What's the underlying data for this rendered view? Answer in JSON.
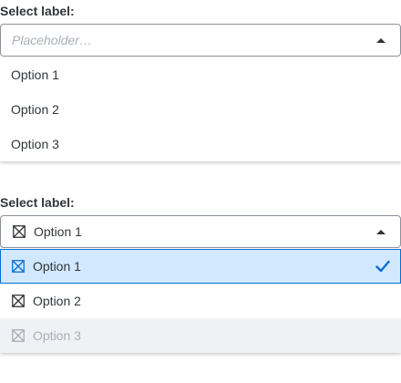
{
  "select1": {
    "label": "Select label:",
    "placeholder": "Placeholder…",
    "options": [
      {
        "label": "Option 1"
      },
      {
        "label": "Option 2"
      },
      {
        "label": "Option 3"
      }
    ]
  },
  "select2": {
    "label": "Select label:",
    "selected_value": "Option 1",
    "options": [
      {
        "label": "Option 1",
        "icon": "x-box-icon",
        "state": "selected"
      },
      {
        "label": "Option 2",
        "icon": "x-box-icon",
        "state": "normal"
      },
      {
        "label": "Option 3",
        "icon": "x-box-icon",
        "state": "disabled"
      }
    ]
  },
  "colors": {
    "accent": "#0a6ed1",
    "selected_bg": "#d1e8ff",
    "disabled_bg": "#eff1f4",
    "text": "#32363a",
    "placeholder": "#a9b0b7",
    "border": "#89919a"
  }
}
